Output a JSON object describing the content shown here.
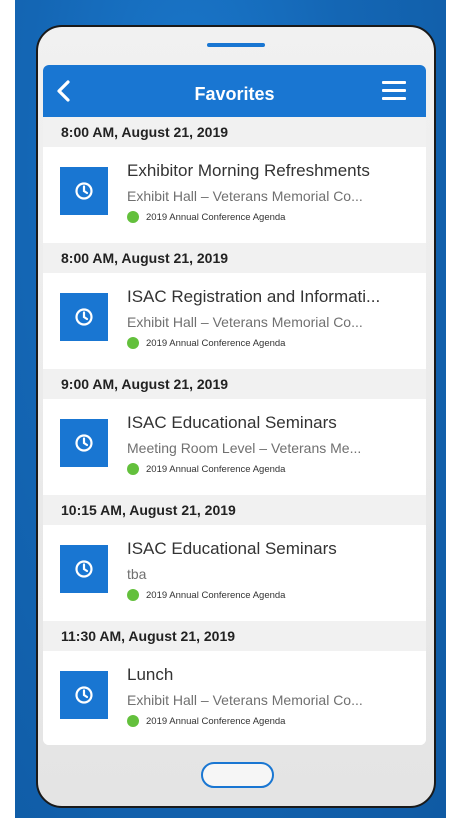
{
  "header": {
    "title": "Favorites"
  },
  "tag_color": "#63c03c",
  "accent_color": "#1976d2",
  "icons": {
    "back": "chevron-left-icon",
    "menu": "hamburger-menu-icon",
    "item": "clock-icon"
  },
  "groups": [
    {
      "time": "8:00 AM, August 21, 2019",
      "item": {
        "title": "Exhibitor Morning Refreshments",
        "location": "Exhibit Hall – Veterans Memorial Co...",
        "tag": "2019 Annual Conference Agenda"
      }
    },
    {
      "time": "8:00 AM, August 21, 2019",
      "item": {
        "title": "ISAC Registration and Informati...",
        "location": "Exhibit Hall – Veterans Memorial Co...",
        "tag": "2019 Annual Conference Agenda"
      }
    },
    {
      "time": "9:00 AM, August 21, 2019",
      "item": {
        "title": "ISAC Educational Seminars",
        "location": "Meeting Room Level – Veterans Me...",
        "tag": "2019 Annual Conference Agenda"
      }
    },
    {
      "time": "10:15 AM, August 21, 2019",
      "item": {
        "title": "ISAC Educational Seminars",
        "location": "tba",
        "tag": "2019 Annual Conference Agenda"
      }
    },
    {
      "time": "11:30 AM, August 21, 2019",
      "item": {
        "title": "Lunch",
        "location": "Exhibit Hall – Veterans Memorial Co...",
        "tag": "2019 Annual Conference Agenda"
      }
    }
  ]
}
